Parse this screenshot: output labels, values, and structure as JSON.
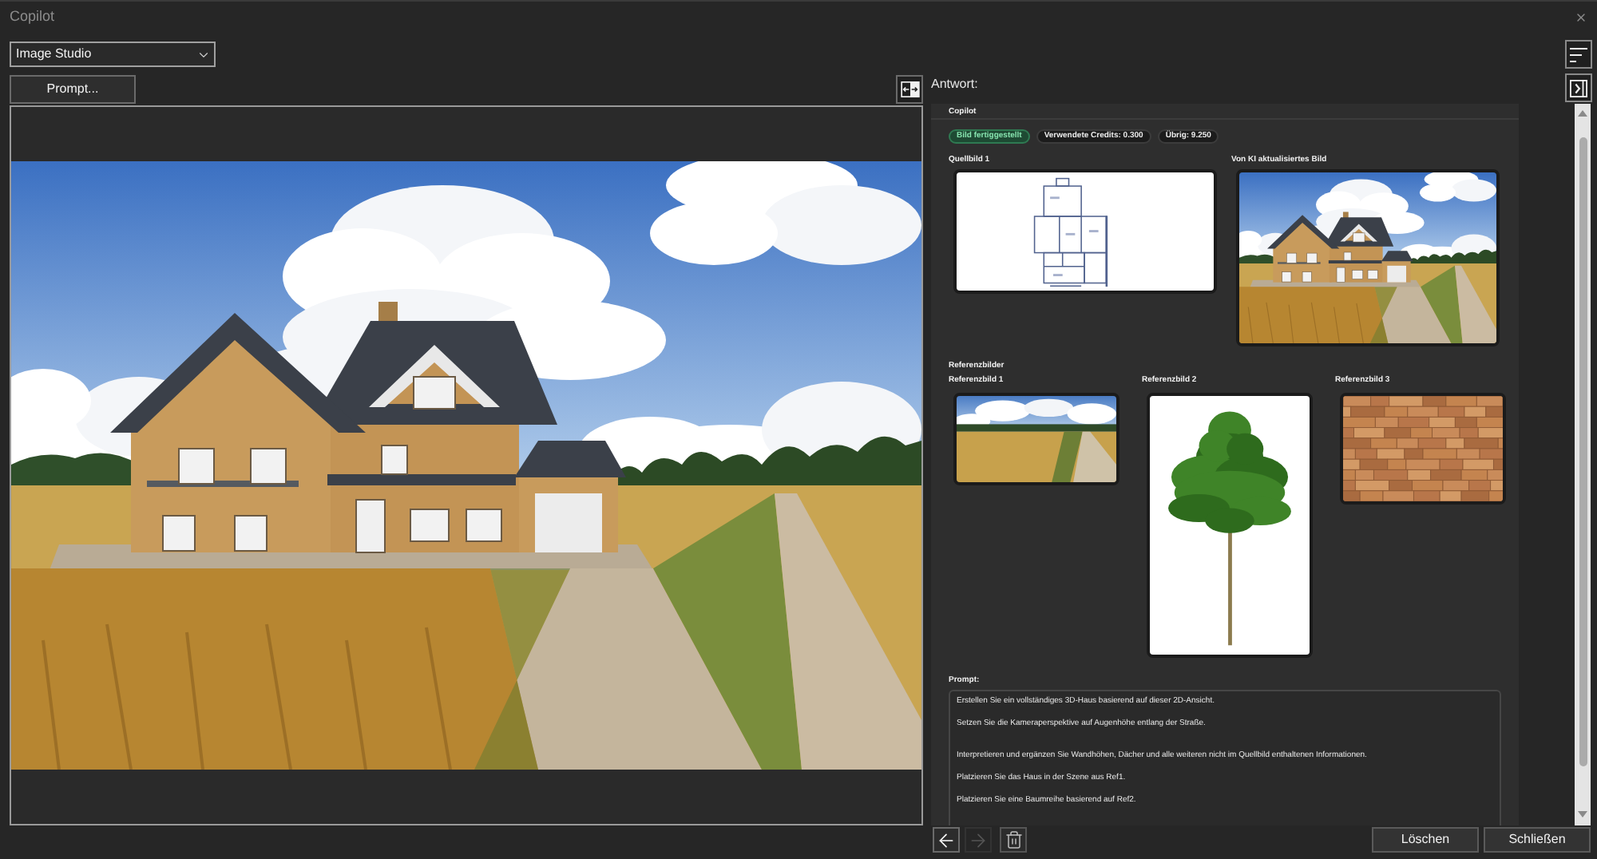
{
  "window": {
    "title": "Copilot"
  },
  "mode_select": {
    "value": "Image Studio"
  },
  "prompt_button": {
    "label": "Prompt..."
  },
  "preview": {
    "kind": "house_scene"
  },
  "response": {
    "label": "Antwort:",
    "section_title": "Copilot",
    "badges": [
      {
        "text": "Bild fertiggestellt",
        "kind": "status"
      },
      {
        "text": "Verwendete Credits: 0.300",
        "kind": "info"
      },
      {
        "text": "Übrig: 9.250",
        "kind": "info"
      }
    ],
    "images": [
      {
        "label": "Quellbild 1",
        "kind": "floor_plan"
      },
      {
        "label": "Von KI aktualisiertes Bild",
        "kind": "house_scene"
      }
    ],
    "references": {
      "title": "Referenzbilder",
      "items": [
        {
          "label": "Referenzbild 1",
          "kind": "field"
        },
        {
          "label": "Referenzbild 2",
          "kind": "tree"
        },
        {
          "label": "Referenzbild 3",
          "kind": "wall"
        }
      ]
    },
    "prompt": {
      "label": "Prompt:",
      "paragraphs": [
        [
          "Erstellen Sie ein vollständiges 3D-Haus basierend auf dieser 2D-Ansicht.",
          "Setzen Sie die Kameraperspektive auf Augenhöhe entlang der Straße."
        ],
        [
          "Interpretieren und ergänzen Sie Wandhöhen, Dächer und alle weiteren nicht im Quellbild enthaltenen Informationen.",
          "Platzieren Sie das Haus in der Szene aus Ref1.",
          "Platzieren Sie eine Baumreihe basierend auf Ref2."
        ]
      ]
    }
  },
  "navigation": [
    {
      "kind": "back",
      "disabled": false
    },
    {
      "kind": "forward",
      "disabled": true
    }
  ],
  "actions": [
    {
      "label": "Löschen"
    },
    {
      "label": "Schließen"
    }
  ]
}
